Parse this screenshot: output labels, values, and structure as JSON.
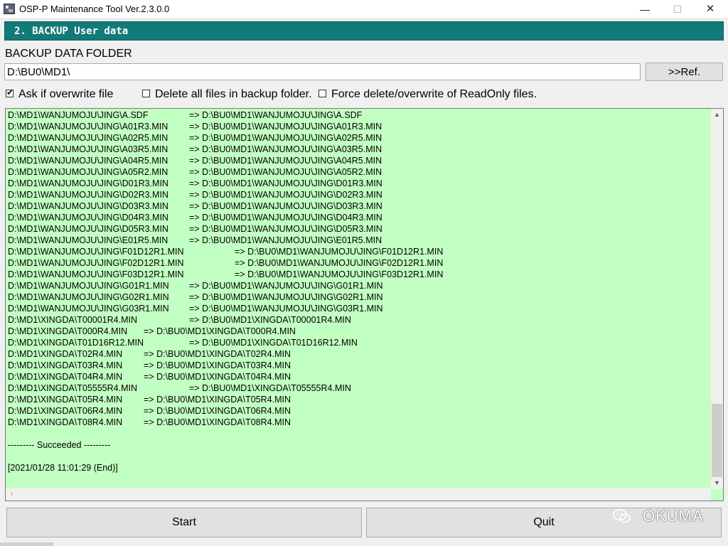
{
  "window": {
    "title": "OSP-P Maintenance Tool Ver.2.3.0.0",
    "controls": {
      "minimize": "—",
      "maximize": "☐",
      "close": "✕"
    }
  },
  "header": {
    "section_title": "2. BACKUP User data"
  },
  "folder": {
    "label": "BACKUP DATA FOLDER",
    "value": "D:\\BU0\\MD1\\",
    "ref_button": ">>Ref."
  },
  "options": [
    {
      "label": "Ask if overwrite file",
      "checked": true
    },
    {
      "label": "Delete all files in backup folder.",
      "checked": false
    },
    {
      "label": "Force delete/overwrite of ReadOnly files.",
      "checked": false
    }
  ],
  "log": {
    "lines": [
      {
        "src": "D:\\MD1\\WANJUMOJU\\JING\\A.SDF",
        "dst": "=> D:\\BU0\\MD1\\WANJUMOJU\\JING\\A.SDF",
        "tab": 1
      },
      {
        "src": "D:\\MD1\\WANJUMOJU\\JING\\A01R3.MIN",
        "dst": "=> D:\\BU0\\MD1\\WANJUMOJU\\JING\\A01R3.MIN",
        "tab": 1
      },
      {
        "src": "D:\\MD1\\WANJUMOJU\\JING\\A02R5.MIN",
        "dst": "=> D:\\BU0\\MD1\\WANJUMOJU\\JING\\A02R5.MIN",
        "tab": 1
      },
      {
        "src": "D:\\MD1\\WANJUMOJU\\JING\\A03R5.MIN",
        "dst": "=> D:\\BU0\\MD1\\WANJUMOJU\\JING\\A03R5.MIN",
        "tab": 1
      },
      {
        "src": "D:\\MD1\\WANJUMOJU\\JING\\A04R5.MIN",
        "dst": "=> D:\\BU0\\MD1\\WANJUMOJU\\JING\\A04R5.MIN",
        "tab": 1
      },
      {
        "src": "D:\\MD1\\WANJUMOJU\\JING\\A05R2.MIN",
        "dst": "=> D:\\BU0\\MD1\\WANJUMOJU\\JING\\A05R2.MIN",
        "tab": 1
      },
      {
        "src": "D:\\MD1\\WANJUMOJU\\JING\\D01R3.MIN",
        "dst": "=> D:\\BU0\\MD1\\WANJUMOJU\\JING\\D01R3.MIN",
        "tab": 1
      },
      {
        "src": "D:\\MD1\\WANJUMOJU\\JING\\D02R3.MIN",
        "dst": "=> D:\\BU0\\MD1\\WANJUMOJU\\JING\\D02R3.MIN",
        "tab": 1
      },
      {
        "src": "D:\\MD1\\WANJUMOJU\\JING\\D03R3.MIN",
        "dst": "=> D:\\BU0\\MD1\\WANJUMOJU\\JING\\D03R3.MIN",
        "tab": 1
      },
      {
        "src": "D:\\MD1\\WANJUMOJU\\JING\\D04R3.MIN",
        "dst": "=> D:\\BU0\\MD1\\WANJUMOJU\\JING\\D04R3.MIN",
        "tab": 1
      },
      {
        "src": "D:\\MD1\\WANJUMOJU\\JING\\D05R3.MIN",
        "dst": "=> D:\\BU0\\MD1\\WANJUMOJU\\JING\\D05R3.MIN",
        "tab": 1
      },
      {
        "src": "D:\\MD1\\WANJUMOJU\\JING\\E01R5.MIN",
        "dst": "=> D:\\BU0\\MD1\\WANJUMOJU\\JING\\E01R5.MIN",
        "tab": 1
      },
      {
        "src": "D:\\MD1\\WANJUMOJU\\JING\\F01D12R1.MIN",
        "dst": "=> D:\\BU0\\MD1\\WANJUMOJU\\JING\\F01D12R1.MIN",
        "tab": 2
      },
      {
        "src": "D:\\MD1\\WANJUMOJU\\JING\\F02D12R1.MIN",
        "dst": "=> D:\\BU0\\MD1\\WANJUMOJU\\JING\\F02D12R1.MIN",
        "tab": 2
      },
      {
        "src": "D:\\MD1\\WANJUMOJU\\JING\\F03D12R1.MIN",
        "dst": "=> D:\\BU0\\MD1\\WANJUMOJU\\JING\\F03D12R1.MIN",
        "tab": 2
      },
      {
        "src": "D:\\MD1\\WANJUMOJU\\JING\\G01R1.MIN",
        "dst": "=> D:\\BU0\\MD1\\WANJUMOJU\\JING\\G01R1.MIN",
        "tab": 1
      },
      {
        "src": "D:\\MD1\\WANJUMOJU\\JING\\G02R1.MIN",
        "dst": "=> D:\\BU0\\MD1\\WANJUMOJU\\JING\\G02R1.MIN",
        "tab": 1
      },
      {
        "src": "D:\\MD1\\WANJUMOJU\\JING\\G03R1.MIN",
        "dst": "=> D:\\BU0\\MD1\\WANJUMOJU\\JING\\G03R1.MIN",
        "tab": 1
      },
      {
        "src": "D:\\MD1\\XINGDA\\T00001R4.MIN",
        "dst": "=> D:\\BU0\\MD1\\XINGDA\\T00001R4.MIN",
        "tab": 1
      },
      {
        "src": "D:\\MD1\\XINGDA\\T000R4.MIN",
        "dst": "=> D:\\BU0\\MD1\\XINGDA\\T000R4.MIN",
        "tab": 3
      },
      {
        "src": "D:\\MD1\\XINGDA\\T01D16R12.MIN",
        "dst": "=> D:\\BU0\\MD1\\XINGDA\\T01D16R12.MIN",
        "tab": 1
      },
      {
        "src": "D:\\MD1\\XINGDA\\T02R4.MIN",
        "dst": "=> D:\\BU0\\MD1\\XINGDA\\T02R4.MIN",
        "tab": 3
      },
      {
        "src": "D:\\MD1\\XINGDA\\T03R4.MIN",
        "dst": "=> D:\\BU0\\MD1\\XINGDA\\T03R4.MIN",
        "tab": 3
      },
      {
        "src": "D:\\MD1\\XINGDA\\T04R4.MIN",
        "dst": "=> D:\\BU0\\MD1\\XINGDA\\T04R4.MIN",
        "tab": 3
      },
      {
        "src": "D:\\MD1\\XINGDA\\T05555R4.MIN",
        "dst": "=> D:\\BU0\\MD1\\XINGDA\\T05555R4.MIN",
        "tab": 1
      },
      {
        "src": "D:\\MD1\\XINGDA\\T05R4.MIN",
        "dst": "=> D:\\BU0\\MD1\\XINGDA\\T05R4.MIN",
        "tab": 3
      },
      {
        "src": "D:\\MD1\\XINGDA\\T06R4.MIN",
        "dst": "=> D:\\BU0\\MD1\\XINGDA\\T06R4.MIN",
        "tab": 3
      },
      {
        "src": "D:\\MD1\\XINGDA\\T08R4.MIN",
        "dst": "=> D:\\BU0\\MD1\\XINGDA\\T08R4.MIN",
        "tab": 3
      },
      {
        "src": "",
        "dst": "",
        "tab": 0
      },
      {
        "src": "--------- Succeeded ---------",
        "dst": "",
        "tab": 0
      },
      {
        "src": "",
        "dst": "",
        "tab": 0
      },
      {
        "src": "[2021/01/28 11:01:29 (End)]",
        "dst": "",
        "tab": 0
      }
    ],
    "scroll_position": 0.78
  },
  "buttons": {
    "start": "Start",
    "quit": "Quit"
  },
  "watermark": {
    "text": "OKUMA",
    "icon": "wechat-icon"
  },
  "colors": {
    "header": "#127a78",
    "log_background": "#c2ffc2"
  }
}
